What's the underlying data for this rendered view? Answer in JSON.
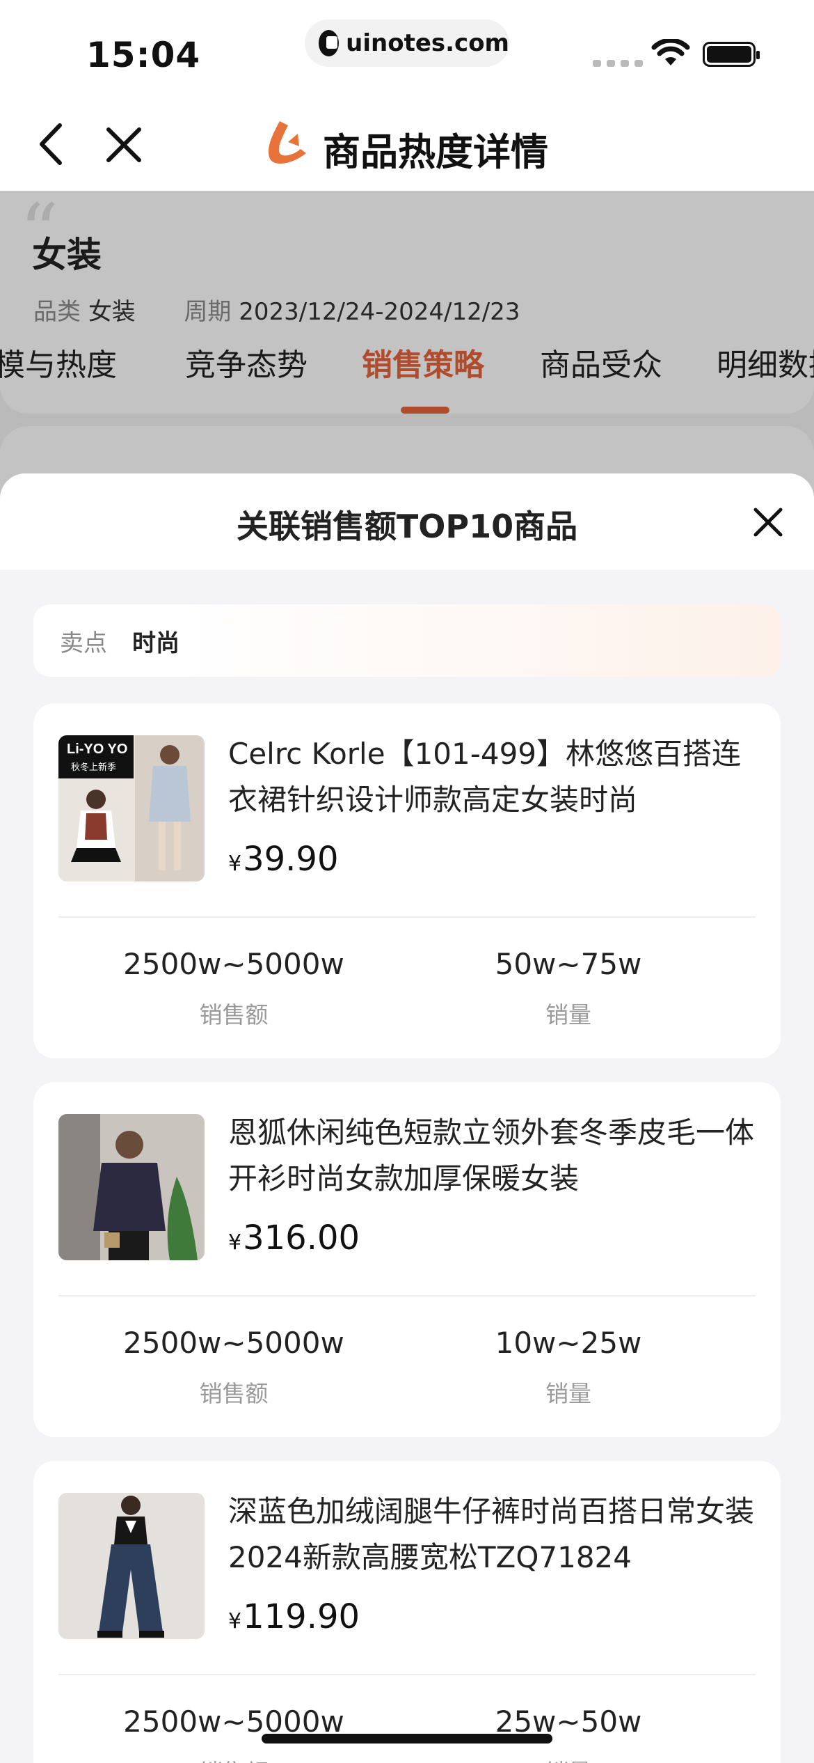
{
  "status_bar": {
    "time": "15:04",
    "url": "uinotes.com"
  },
  "nav": {
    "title": "商品热度详情",
    "back_icon": "chevron-left-icon",
    "close_icon": "close-icon",
    "logo_color": "#e8733a"
  },
  "background_page": {
    "category_title": "女装",
    "meta": {
      "category_label": "品类",
      "category_value": "女装",
      "period_label": "周期",
      "period_value": "2023/12/24-2024/12/23"
    },
    "tabs": [
      {
        "label": "规模与热度",
        "active": false
      },
      {
        "label": "竞争态势",
        "active": false
      },
      {
        "label": "销售策略",
        "active": true
      },
      {
        "label": "商品受众",
        "active": false
      },
      {
        "label": "明细数据",
        "active": false
      }
    ],
    "accent_color": "#e0623b"
  },
  "sheet": {
    "title": "关联销售额TOP10商品",
    "close_icon": "close-icon",
    "selling_point": {
      "label": "卖点",
      "value": "时尚"
    },
    "products": [
      {
        "title": "Celrc Korle【101-499】林悠悠百搭连衣裙针织设计师款高定女装时尚",
        "currency": "¥",
        "price": "39.90",
        "sales_amount": "2500w~5000w",
        "sales_amount_label": "销售额",
        "sales_volume": "50w~75w",
        "sales_volume_label": "销量",
        "thumb_badge_line1": "Li-YO YO",
        "thumb_badge_line2": "秋冬上新季"
      },
      {
        "title": "恩狐休闲纯色短款立领外套冬季皮毛一体开衫时尚女款加厚保暖女装",
        "currency": "¥",
        "price": "316.00",
        "sales_amount": "2500w~5000w",
        "sales_amount_label": "销售额",
        "sales_volume": "10w~25w",
        "sales_volume_label": "销量"
      },
      {
        "title": "深蓝色加绒阔腿牛仔裤时尚百搭日常女装2024新款高腰宽松TZQ71824",
        "currency": "¥",
        "price": "119.90",
        "sales_amount": "2500w~5000w",
        "sales_amount_label": "销售额",
        "sales_volume": "25w~50w",
        "sales_volume_label": "销量"
      }
    ]
  }
}
